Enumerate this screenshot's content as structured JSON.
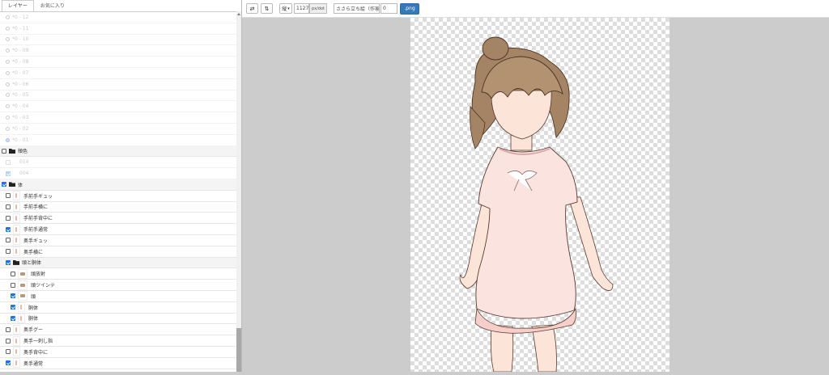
{
  "sidebar": {
    "tabs": [
      {
        "label": "レイヤー"
      },
      {
        "label": "お気に入り"
      }
    ],
    "radio_rows": [
      {
        "label": "*0 - 12",
        "selected": false
      },
      {
        "label": "*0 - 11",
        "selected": false
      },
      {
        "label": "*0 - 10",
        "selected": false
      },
      {
        "label": "*0 - 09",
        "selected": false
      },
      {
        "label": "*0 - 08",
        "selected": false
      },
      {
        "label": "*0 - 07",
        "selected": false
      },
      {
        "label": "*0 - 06",
        "selected": false
      },
      {
        "label": "*0 - 05",
        "selected": false
      },
      {
        "label": "*0 - 04",
        "selected": false
      },
      {
        "label": "*0 - 03",
        "selected": false
      },
      {
        "label": "*0 - 02",
        "selected": false
      },
      {
        "label": "*0 - 01",
        "selected": true
      }
    ],
    "folder_cheek": {
      "label": "頬色",
      "checked": false
    },
    "cheek_items": [
      {
        "label": "014",
        "checked": false
      },
      {
        "label": "004",
        "checked": true
      }
    ],
    "folder_body": {
      "label": "体",
      "checked": true
    },
    "body_items": [
      {
        "label": "手前手ギュッ",
        "checked": false
      },
      {
        "label": "手前手横に",
        "checked": false
      },
      {
        "label": "手前手背中に",
        "checked": false
      },
      {
        "label": "手前手通常",
        "checked": true
      },
      {
        "label": "奥手ギュッ",
        "checked": false
      },
      {
        "label": "奥手横に",
        "checked": false
      }
    ],
    "folder_head": {
      "label": "頭と胴体",
      "checked": true
    },
    "head_items": [
      {
        "label": "頭放射",
        "checked": false
      },
      {
        "label": "頭ツインテ",
        "checked": false
      },
      {
        "label": "頭",
        "checked": true
      },
      {
        "label": "胴体",
        "checked": true
      },
      {
        "label": "胴体",
        "checked": true
      }
    ],
    "bottom_items": [
      {
        "label": "奥手グー",
        "checked": false
      },
      {
        "label": "奥手一刺し指",
        "checked": false
      },
      {
        "label": "奥手背中に",
        "checked": false
      },
      {
        "label": "奥手通常",
        "checked": true
      }
    ]
  },
  "toolbar": {
    "flip_h_icon": "⇄",
    "flip_v_icon": "⇅",
    "orientation_select": "縦",
    "size_value": "1127",
    "size_unit": "px/dot",
    "filename_value": "ささら立ち絵（作家",
    "number_value": "0",
    "export_label": ".png"
  }
}
